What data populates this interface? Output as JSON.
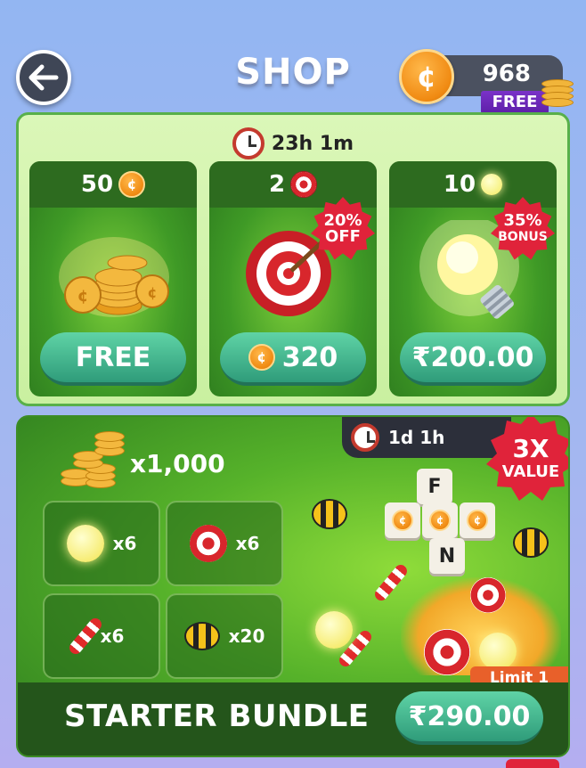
{
  "header": {
    "title": "SHOP",
    "back_icon": "back-arrow-icon",
    "currency": {
      "icon": "coin-icon",
      "amount": "968",
      "tag": "FREE"
    }
  },
  "daily_offers": {
    "timer": "23h 1m",
    "cards": [
      {
        "quantity": "50",
        "item_icon": "coin-icon",
        "price": "FREE",
        "price_icon": null,
        "badge": null
      },
      {
        "quantity": "2",
        "item_icon": "target-icon",
        "price": "320",
        "price_icon": "coin-icon",
        "badge": {
          "line1": "20%",
          "line2": "OFF"
        }
      },
      {
        "quantity": "10",
        "item_icon": "lightbulb-icon",
        "price": "₹200.00",
        "price_icon": null,
        "badge": {
          "line1": "35%",
          "line2": "BONUS"
        }
      }
    ]
  },
  "bundle": {
    "timer": "1d 1h",
    "badge": {
      "line1": "3X",
      "line2": "VALUE"
    },
    "coins_amount": "x1,000",
    "items": [
      {
        "icon": "lightbulb-icon",
        "count": "x6"
      },
      {
        "icon": "target-icon",
        "count": "x6"
      },
      {
        "icon": "rocket-icon",
        "count": "x6"
      },
      {
        "icon": "bee-icon",
        "count": "x20"
      }
    ],
    "tiles": [
      "F",
      "N"
    ],
    "limit": "Limit 1",
    "name": "STARTER BUNDLE",
    "price": "₹290.00"
  },
  "colors": {
    "background": "#9fb6f2",
    "panel_border": "#58b04a",
    "button_teal": "#3fb58d",
    "badge_red": "#e0233a",
    "free_tag_purple": "#6a27b8"
  }
}
